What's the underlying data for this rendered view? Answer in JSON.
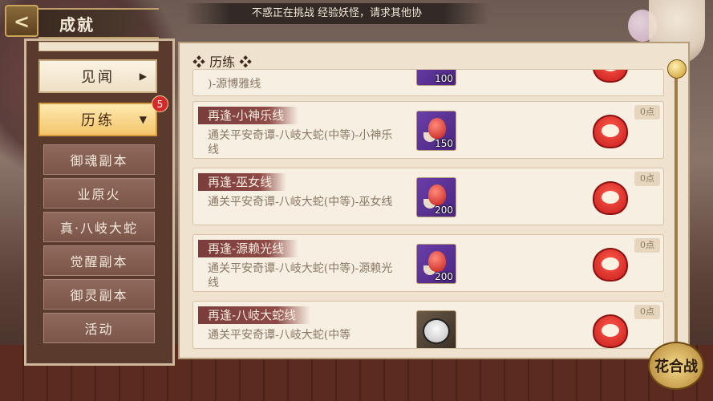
{
  "header": {
    "back_icon": "back-arrow-icon",
    "title": "成就",
    "notice": "不惑正在挑战 经验妖怪，请求其他协"
  },
  "sidebar": {
    "categories": [
      {
        "label": "见闻",
        "arrow": "▶"
      },
      {
        "label": "历练",
        "arrow": "▼",
        "active": true,
        "badge": "5"
      }
    ],
    "sub_items": [
      "御魂副本",
      "业原火",
      "真·八岐大蛇",
      "觉醒副本",
      "御灵副本",
      "活动"
    ]
  },
  "panel": {
    "title": "❖ 历练 ❖",
    "partial_top": {
      "desc": ")-源博雅线",
      "qty": "100"
    },
    "entries": [
      {
        "name": "再逢-小神乐线",
        "desc": "通关平安奇谭-八岐大蛇(中等)-小神乐线",
        "qty": "150",
        "points": "0点",
        "reward_icon": "red-soul-jade-icon"
      },
      {
        "name": "再逢-巫女线",
        "desc": "通关平安奇谭-八岐大蛇(中等)-巫女线",
        "qty": "200",
        "points": "0点",
        "reward_icon": "red-soul-jade-icon"
      },
      {
        "name": "再逢-源赖光线",
        "desc": "通关平安奇谭-八岐大蛇(中等)-源赖光线",
        "qty": "200",
        "points": "0点",
        "reward_icon": "red-soul-jade-icon"
      },
      {
        "name": "再逢-八岐大蛇线",
        "desc": "通关平安奇谭-八岐大蛇(中等",
        "qty": "",
        "points": "0点",
        "reward_icon": "shikigami-portrait-icon"
      }
    ]
  },
  "corner_button": "花合战",
  "colors": {
    "accent_red": "#c61c1c",
    "active_tab": "#f3c56a",
    "panel_bg": "#efe2cf",
    "name_banner": "#7a3d3b"
  }
}
